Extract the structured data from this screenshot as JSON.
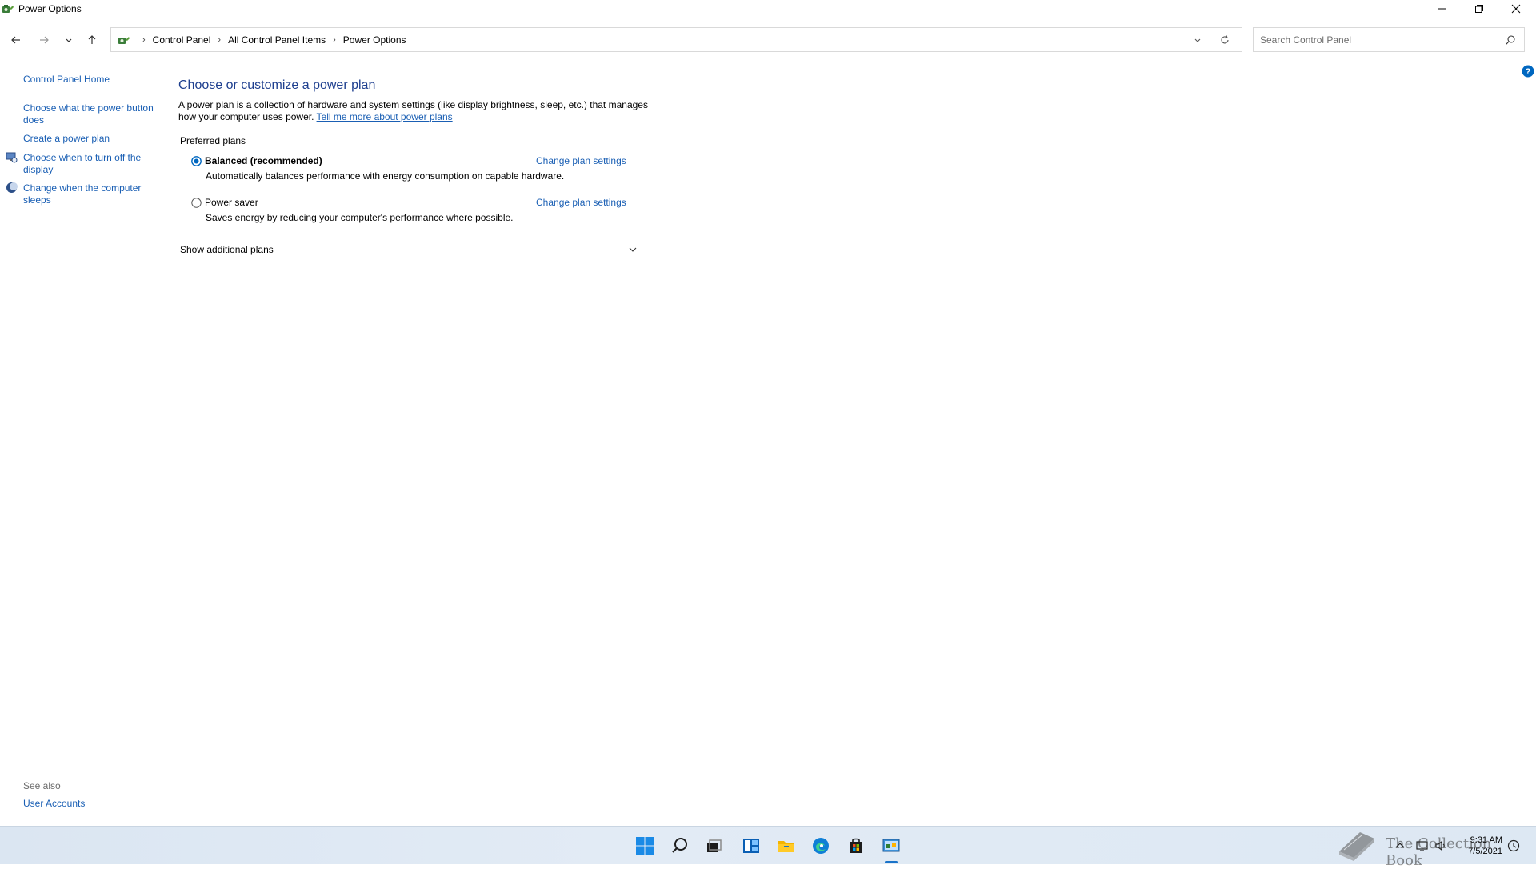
{
  "window": {
    "title": "Power Options"
  },
  "address_bar": {
    "crumbs": [
      "Control Panel",
      "All Control Panel Items",
      "Power Options"
    ]
  },
  "search": {
    "placeholder": "Search Control Panel"
  },
  "sidebar": {
    "home": "Control Panel Home",
    "links": [
      "Choose what the power button does",
      "Create a power plan",
      "Choose when to turn off the display",
      "Change when the computer sleeps"
    ],
    "see_also_label": "See also",
    "see_also_links": [
      "User Accounts"
    ]
  },
  "main": {
    "title": "Choose or customize a power plan",
    "intro_text": "A power plan is a collection of hardware and system settings (like display brightness, sleep, etc.) that manages how your computer uses power.",
    "intro_link": "Tell me more about power plans",
    "preferred_label": "Preferred plans",
    "plans": [
      {
        "name": "Balanced (recommended)",
        "selected": true,
        "change_label": "Change plan settings",
        "description": "Automatically balances performance with energy consumption on capable hardware."
      },
      {
        "name": "Power saver",
        "selected": false,
        "change_label": "Change plan settings",
        "description": "Saves energy by reducing your computer's performance where possible."
      }
    ],
    "additional_label": "Show additional plans"
  },
  "taskbar": {
    "apps": [
      "start-icon",
      "search-icon",
      "task-view-icon",
      "widgets-icon",
      "file-explorer-icon",
      "edge-icon",
      "store-icon",
      "control-panel-icon"
    ],
    "active_app": "control-panel-icon",
    "clock_time": "9:31 AM",
    "clock_date": "7/5/2021"
  },
  "watermark": {
    "text": "The Collection Book"
  },
  "colors": {
    "link": "#1a5fb4",
    "title": "#1e3f8f",
    "accent": "#0067c0"
  }
}
